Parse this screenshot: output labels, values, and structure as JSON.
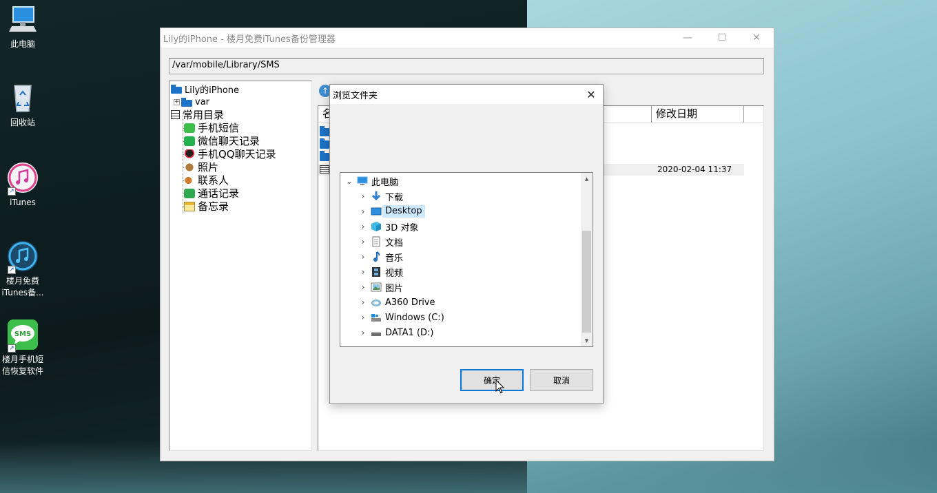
{
  "desktop": {
    "icons": [
      {
        "label": "此电脑",
        "icon": "computer-icon"
      },
      {
        "label": "回收站",
        "icon": "recycle-bin-icon"
      },
      {
        "label": "iTunes",
        "icon": "itunes-icon"
      },
      {
        "label": "楼月免费\niTunes备...",
        "line1": "楼月免费",
        "line2": "iTunes备..."
      },
      {
        "label": "楼月手机短信恢复软件",
        "line1": "楼月手机短",
        "line2": "信恢复软件",
        "badge": "SMS"
      }
    ]
  },
  "main_window": {
    "title": "Lily的iPhone - 楼月免费iTunes备份管理器",
    "path": "/var/mobile/Library/SMS",
    "tree": {
      "root": "Lily的iPhone",
      "var": "var",
      "common": "常用目录",
      "items": [
        "手机短信",
        "微信聊天记录",
        "手机QQ聊天记录",
        "照片",
        "联系人",
        "通话记录",
        "备忘录"
      ]
    },
    "list": {
      "col_name": "名",
      "col_modified": "修改日期",
      "row_date": "2020-02-04 11:37"
    }
  },
  "dialog": {
    "title": "浏览文件夹",
    "root": "此电脑",
    "nodes": [
      "下载",
      "Desktop",
      "3D 对象",
      "文档",
      "音乐",
      "视频",
      "图片",
      "A360 Drive",
      "Windows (C:)",
      "DATA1 (D:)"
    ],
    "selected": "Desktop",
    "ok_label": "确定",
    "cancel_label": "取消"
  },
  "colors": {
    "accent": "#0078d7",
    "selection": "#cce8ff",
    "folder": "#1d73c8"
  }
}
